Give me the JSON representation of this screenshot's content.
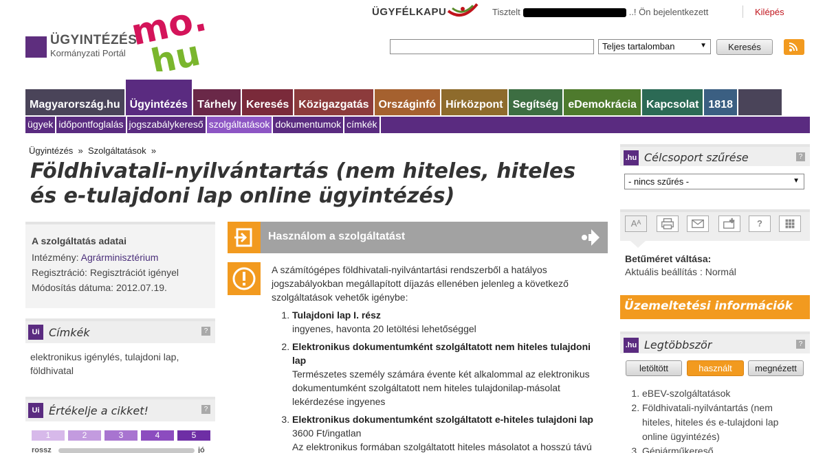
{
  "header": {
    "logo_title": "ÜGYINTÉZÉS",
    "logo_subtitle": "Kormányzati Portál",
    "ugyfelkapu": "ÜGYFÉLKAPU",
    "greeting_prefix": "Tisztelt",
    "greeting_suffix": "..! Ön bejelentkezett",
    "logout": "Kilépés",
    "search": {
      "value": "",
      "scope": "Teljes tartalomban",
      "button": "Keresés"
    }
  },
  "nav": {
    "items": [
      {
        "label": "Magyarország.hu",
        "color": "#4a4459"
      },
      {
        "label": "Ügyintézés",
        "color": "#5a2b80"
      },
      {
        "label": "Tárhely",
        "color": "#6a2848"
      },
      {
        "label": "Keresés",
        "color": "#7a2a3a"
      },
      {
        "label": "Közigazgatás",
        "color": "#8c3b3c"
      },
      {
        "label": "Országinfó",
        "color": "#a5612f"
      },
      {
        "label": "Hírközpont",
        "color": "#8e6b2c"
      },
      {
        "label": "Segítség",
        "color": "#3d6e42"
      },
      {
        "label": "eDemokrácia",
        "color": "#4e7a2d"
      },
      {
        "label": "Kapcsolat",
        "color": "#2c6a55"
      },
      {
        "label": "1818",
        "color": "#3b5f82"
      }
    ],
    "sub_items": [
      "ügyek",
      "időpontfoglalás",
      "jogszabálykereső",
      "szolgáltatások",
      "dokumentumok",
      "címkék"
    ]
  },
  "breadcrumb": {
    "home": "Ügyintézés",
    "current": "Szolgáltatások",
    "sep": "»"
  },
  "page_title": "Földhivatali-nyilvántartás (nem hiteles, hiteles és e-tulajdoni lap online ügyintézés)",
  "service_info": {
    "title": "A szolgáltatás adatai",
    "institution_label": "Intézmény:",
    "institution_value": "Agrárminisztérium",
    "registration_label": "Regisztráció:",
    "registration_value": "Regisztrációt igényel",
    "modified_label": "Módosítás dátuma:",
    "modified_value": "2012.07.19."
  },
  "tags_box": {
    "logo": "Ui",
    "title": "Címkék",
    "help": "?",
    "text": "elektronikus igénylés, tulajdoni lap, földhivatal"
  },
  "rating_box": {
    "logo": "Ui",
    "title": "Értékelje a cikket!",
    "help": "?",
    "levels": [
      "1",
      "2",
      "3",
      "4",
      "5"
    ],
    "low": "rossz",
    "high": "jó"
  },
  "use_service": {
    "label": "Használom a szolgáltatást"
  },
  "content": {
    "intro": "A számítógépes földhivatali-nyilvántartási rendszerből a hatályos jogszabályokban megállapított díjazás ellenében jelenleg a következő szolgáltatások vehetők igénybe:",
    "items": [
      {
        "title": "Tulajdoni lap I. rész",
        "desc": "ingyenes, havonta 20 letöltési lehetőséggel"
      },
      {
        "title": "Elektronikus dokumentumként szolgáltatott nem hiteles tulajdoni lap",
        "desc": "Természetes személy számára évente két alkalommal az elektronikus dokumentumként szolgáltatott nem hiteles tulajdonilap-másolat lekérdezése ingyenes"
      },
      {
        "title": "Elektronikus dokumentumként szolgáltatott e-hiteles tulajdoni lap",
        "desc": "3600 Ft/ingatlan",
        "desc2": "Az elektronikus formában szolgáltatott hiteles másolatot a hosszú távú"
      }
    ]
  },
  "filter_box": {
    "logo": ".hu",
    "title": "Célcsoport szűrése",
    "help": "?",
    "selected": "- nincs szűrés -"
  },
  "tools": [
    "AA",
    "print",
    "mail",
    "bookmark",
    "?",
    "grid"
  ],
  "font_size": {
    "title": "Betűméret váltása:",
    "value": "Aktuális beállítás : Normál"
  },
  "operations": {
    "label": "Üzemeltetési információk"
  },
  "most_box": {
    "logo": ".hu",
    "title": "Legtöbbször",
    "help": "?",
    "tabs": [
      "letöltött",
      "használt",
      "megnézett"
    ],
    "active_tab": "használt",
    "list": [
      "eBEV-szolgáltatások",
      "Földhivatali-nyilvántartás (nem hiteles, hiteles és e-tulajdoni lap online ügyintézés)",
      "Gépjárműkereső"
    ]
  },
  "colors": {
    "purple": "#5a2b80",
    "orange": "#f29a1f",
    "red": "#c0141c"
  }
}
